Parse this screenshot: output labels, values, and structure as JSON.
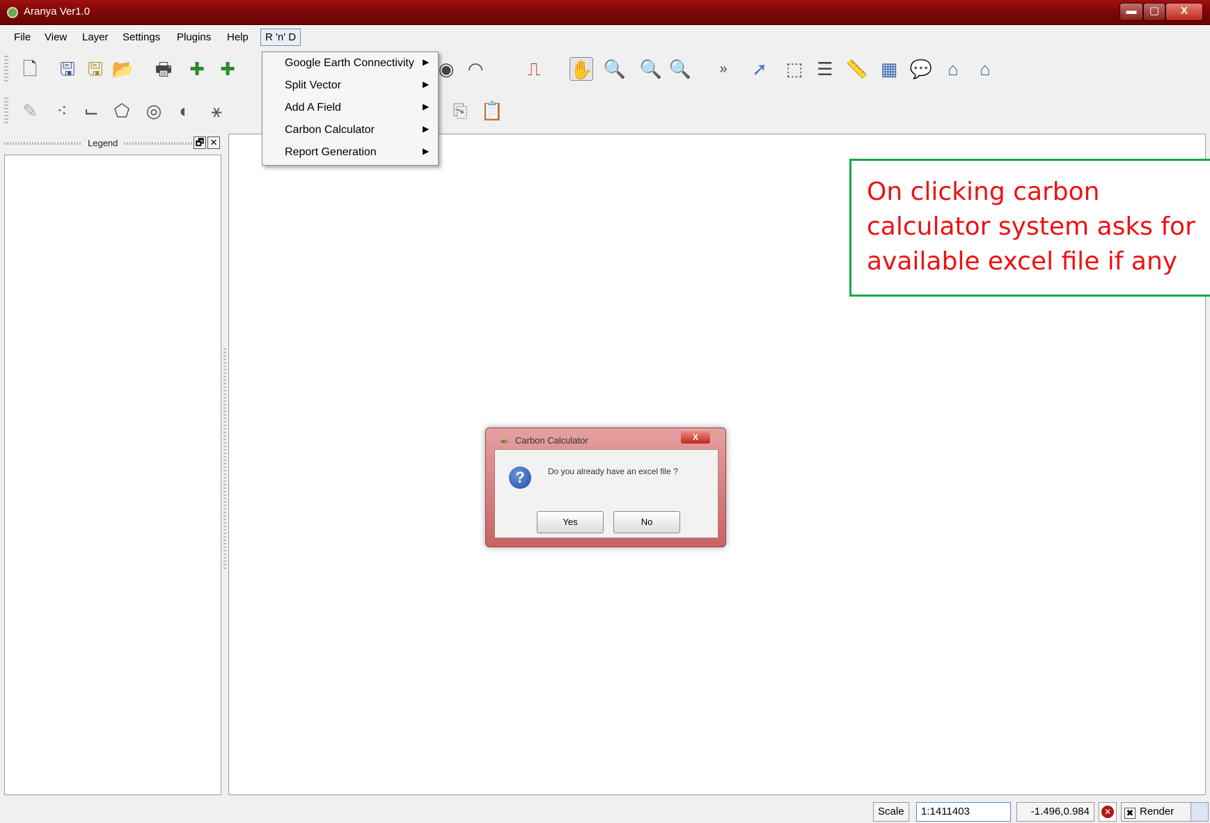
{
  "window": {
    "title": "Aranya Ver1.0",
    "controls": {
      "minimize": "▬",
      "maximize": "▢",
      "close": "X"
    }
  },
  "menubar": {
    "items": [
      "File",
      "View",
      "Layer",
      "Settings",
      "Plugins",
      "Help",
      "R 'n' D"
    ]
  },
  "rnd_menu": {
    "items": [
      {
        "label": "Google Earth Connectivity",
        "has_submenu": true
      },
      {
        "label": "Split Vector",
        "has_submenu": true
      },
      {
        "label": "Add A Field",
        "has_submenu": true
      },
      {
        "label": "Carbon Calculator",
        "has_submenu": true
      },
      {
        "label": "Report Generation",
        "has_submenu": true
      }
    ]
  },
  "toolbar1": {
    "icons": [
      "new-project-icon",
      "save-icon",
      "save-as-icon",
      "open-icon",
      "print-icon",
      "add-vector-layer-icon",
      "add-raster-layer-icon",
      "add-postgis-icon",
      "show-all-icon",
      "hide-all-icon",
      "pdf-icon",
      "pan-icon",
      "zoom-in-icon",
      "zoom-out-icon",
      "zoom-full-icon",
      "more-tools-icon",
      "identify-icon",
      "select-icon",
      "attribute-table-icon",
      "measure-icon",
      "measure-area-icon",
      "map-tips-icon",
      "home-icon",
      "home-bookmark-icon"
    ],
    "overflow_label": "»"
  },
  "toolbar2": {
    "icons": [
      "edit-pencil-icon",
      "capture-point-icon",
      "capture-line-icon",
      "capture-polygon-icon",
      "add-ring-icon",
      "add-island-icon",
      "node-tool-icon",
      "copy-features-icon",
      "paste-features-icon"
    ]
  },
  "legend": {
    "title": "Legend",
    "float_button": "🗗",
    "close_button": "✕"
  },
  "annotation": {
    "text": "On clicking carbon calculator system asks for available excel file if any",
    "border_color": "#17a84a",
    "text_color": "#ee1111"
  },
  "dialog": {
    "title": "Carbon Calculator",
    "message": "Do you already have an excel file ?",
    "close_label": "X",
    "yes_label": "Yes",
    "no_label": "No",
    "icon": "question-icon"
  },
  "statusbar": {
    "scale_label": "Scale",
    "scale_value": "1:1411403",
    "coordinates": "-1.496,0.984",
    "render_label": "Render",
    "render_checked": true
  }
}
